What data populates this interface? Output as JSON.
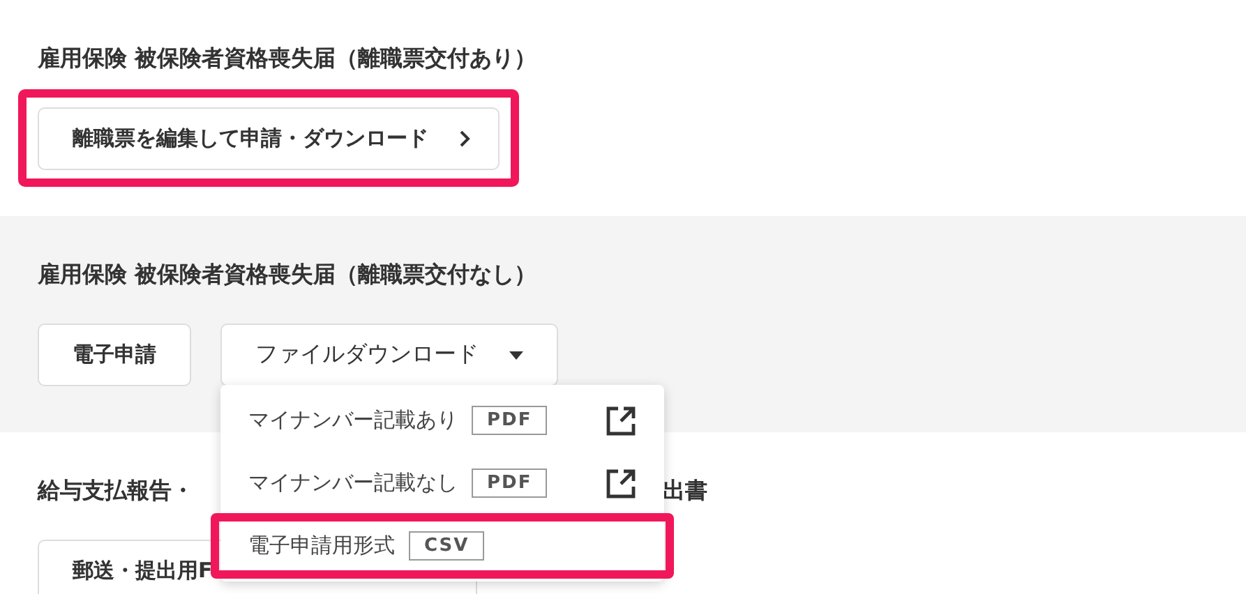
{
  "sections": [
    {
      "title": "雇用保険 被保険者資格喪失届（離職票交付あり）",
      "shaded": false,
      "buttons": [
        {
          "label": "離職票を編集して申請・ダウンロード",
          "kind": "nav",
          "highlighted": true
        }
      ]
    },
    {
      "title": "雇用保険 被保険者資格喪失届（離職票交付なし）",
      "shaded": true,
      "buttons": [
        {
          "label": "電子申請",
          "kind": "plain",
          "highlighted": false
        },
        {
          "label": "ファイルダウンロード",
          "kind": "dropdown",
          "highlighted": false,
          "expanded": true,
          "menu": [
            {
              "label": "マイナンバー記載あり",
              "format": "PDF",
              "external": true,
              "highlighted": false
            },
            {
              "label": "マイナンバー記載なし",
              "format": "PDF",
              "external": true,
              "highlighted": false
            },
            {
              "label": "電子申請用形式",
              "format": "CSV",
              "external": false,
              "highlighted": true
            }
          ]
        }
      ]
    },
    {
      "title": "給与支払報告・",
      "title_tail": "出書",
      "shaded": false,
      "buttons": [
        {
          "label": "郵送・提出用F",
          "kind": "plain",
          "highlighted": false
        }
      ]
    }
  ]
}
